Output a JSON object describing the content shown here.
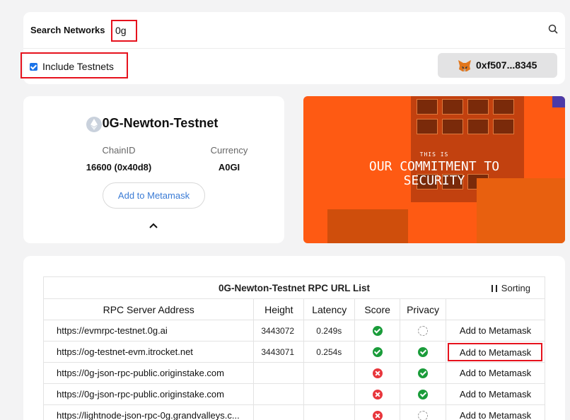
{
  "search": {
    "label": "Search Networks",
    "value": "0g"
  },
  "testnets": {
    "label": "Include Testnets",
    "checked": true
  },
  "wallet": {
    "address": "0xf507...8345"
  },
  "network": {
    "name": "0G-Newton-Testnet",
    "chain_id_label": "ChainID",
    "chain_id_value": "16600 (0x40d8)",
    "currency_label": "Currency",
    "currency_value": "A0GI",
    "add_button": "Add to Metamask"
  },
  "banner": {
    "kicker": "THIS IS",
    "headline_1": "OUR COMMITMENT TO",
    "headline_2": "SECURITY"
  },
  "rpc_table": {
    "title": "0G-Newton-Testnet RPC URL List",
    "sorting_label": "Sorting",
    "headers": [
      "RPC Server Address",
      "Height",
      "Latency",
      "Score",
      "Privacy",
      ""
    ],
    "rows": [
      {
        "url": "https://evmrpc-testnet.0g.ai",
        "height": "3443072",
        "latency": "0.249s",
        "score": "ok",
        "privacy": "none",
        "action": "Add to Metamask"
      },
      {
        "url": "https://og-testnet-evm.itrocket.net",
        "height": "3443071",
        "latency": "0.254s",
        "score": "ok",
        "privacy": "ok",
        "action": "Add to Metamask"
      },
      {
        "url": "https://0g-json-rpc-public.originstake.com",
        "height": "",
        "latency": "",
        "score": "bad",
        "privacy": "ok",
        "action": "Add to Metamask"
      },
      {
        "url": "https://0g-json-rpc-public.originstake.com",
        "height": "",
        "latency": "",
        "score": "bad",
        "privacy": "ok",
        "action": "Add to Metamask"
      },
      {
        "url": "https://lightnode-json-rpc-0g.grandvalleys.c...",
        "height": "",
        "latency": "",
        "score": "bad",
        "privacy": "none",
        "action": "Add to Metamask"
      }
    ]
  },
  "colors": {
    "highlight": "#e6121d",
    "accent": "#1a73e8",
    "ok": "#1a9c3a",
    "bad": "#e8363c",
    "banner": "#fe5a13"
  }
}
